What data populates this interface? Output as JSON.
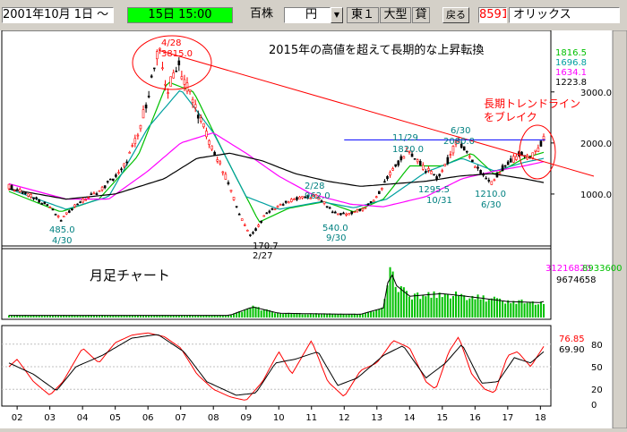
{
  "toolbar": {
    "date_range": "2001年10月 1日 ～",
    "current_time": "15日 15:00",
    "unit_label": "百株",
    "currency_value": "円",
    "market": "東１",
    "size_class": "大型",
    "credit": "貸",
    "back_button": "戻る",
    "stock_code": "8591",
    "stock_name": "オリックス",
    "colors": {
      "time_bg": "#00ff00",
      "code_text": "#ff0000"
    }
  },
  "icons": {
    "dropdown": "dropdown-arrow-icon"
  },
  "chart": {
    "headline": "2015年の高値を超えて長期的な上昇転換",
    "chart_title": "月足チャート",
    "trend_note_line1": "長期トレンドライン",
    "trend_note_line2": "をブレイク",
    "annotations": [
      {
        "text": "4/28",
        "color": "#ff0000"
      },
      {
        "text": "3815.0",
        "color": "#ff0000"
      },
      {
        "text": "485.0",
        "color": "#008080"
      },
      {
        "text": "4/30",
        "color": "#008080"
      },
      {
        "text": "170.7",
        "color": "#000000"
      },
      {
        "text": "2/27",
        "color": "#000000"
      },
      {
        "text": "2/28",
        "color": "#008080"
      },
      {
        "text": "962.0",
        "color": "#008080"
      },
      {
        "text": "540.0",
        "color": "#008080"
      },
      {
        "text": "9/30",
        "color": "#008080"
      },
      {
        "text": "11/29",
        "color": "#008080"
      },
      {
        "text": "1820.0",
        "color": "#008080"
      },
      {
        "text": "6/30",
        "color": "#008080"
      },
      {
        "text": "2080.0",
        "color": "#008080"
      },
      {
        "text": "1295.5",
        "color": "#008080"
      },
      {
        "text": "10/31",
        "color": "#008080"
      },
      {
        "text": "1210.0",
        "color": "#008080"
      },
      {
        "text": "6/30",
        "color": "#008080"
      }
    ],
    "ma_values": [
      {
        "text": "1816.5",
        "color": "#00c000"
      },
      {
        "text": "1696.8",
        "color": "#00a0a0"
      },
      {
        "text": "1634.1",
        "color": "#ff00ff"
      },
      {
        "text": "1223.8",
        "color": "#000000"
      }
    ],
    "volume_values": [
      {
        "text": "31216820",
        "color": "#ff00ff"
      },
      {
        "text": "8933600",
        "color": "#00c000"
      },
      {
        "text": "9674658",
        "color": "#000000"
      }
    ],
    "osc_values": [
      {
        "text": "76.85",
        "color": "#ff0000"
      },
      {
        "text": "69.90",
        "color": "#000000"
      }
    ]
  },
  "chart_data": {
    "type": "line",
    "x_tick_labels": [
      "02",
      "03",
      "04",
      "05",
      "06",
      "07",
      "08",
      "09",
      "10",
      "11",
      "12",
      "13",
      "14",
      "15",
      "16",
      "17",
      "18"
    ],
    "y_tick_labels": [
      "3000.0",
      "2000.0",
      "1000.0"
    ],
    "osc_tick_labels": [
      "80",
      "50",
      "20",
      "0"
    ],
    "y_ticks": [
      3000,
      2000,
      1000
    ],
    "osc_ticks": [
      80,
      50,
      20,
      0
    ],
    "price_range": [
      0,
      4100
    ],
    "osc_range": [
      0,
      100
    ],
    "start_year": 2001.75,
    "end_year": 2018.1,
    "price_key": [
      [
        2001.75,
        1150
      ],
      [
        2002.3,
        1000
      ],
      [
        2003.0,
        750
      ],
      [
        2003.33,
        485
      ],
      [
        2003.8,
        800
      ],
      [
        2004.5,
        1050
      ],
      [
        2005.2,
        1450
      ],
      [
        2005.7,
        2150
      ],
      [
        2006.33,
        3815
      ],
      [
        2006.6,
        3000
      ],
      [
        2006.9,
        3600
      ],
      [
        2007.4,
        2800
      ],
      [
        2007.9,
        2000
      ],
      [
        2008.4,
        1300
      ],
      [
        2008.9,
        450
      ],
      [
        2009.16,
        171
      ],
      [
        2009.6,
        600
      ],
      [
        2010.0,
        780
      ],
      [
        2010.5,
        900
      ],
      [
        2011.16,
        962
      ],
      [
        2011.7,
        620
      ],
      [
        2012.0,
        600
      ],
      [
        2012.6,
        700
      ],
      [
        2013.0,
        950
      ],
      [
        2013.4,
        1400
      ],
      [
        2013.9,
        1820
      ],
      [
        2014.4,
        1550
      ],
      [
        2014.83,
        1295
      ],
      [
        2015.2,
        1700
      ],
      [
        2015.5,
        2080
      ],
      [
        2015.8,
        1750
      ],
      [
        2016.2,
        1400
      ],
      [
        2016.5,
        1210
      ],
      [
        2016.9,
        1550
      ],
      [
        2017.4,
        1800
      ],
      [
        2017.7,
        1700
      ],
      [
        2018.0,
        1950
      ],
      [
        2018.1,
        2050
      ]
    ],
    "trendline": [
      [
        2006.33,
        3815
      ],
      [
        2018.6,
        1700
      ]
    ],
    "horizontal_line": 2060,
    "ma_series": [
      {
        "color": "#00c000",
        "key": [
          [
            2001.75,
            1050
          ],
          [
            2003.33,
            650
          ],
          [
            2004.5,
            900
          ],
          [
            2005.7,
            1750
          ],
          [
            2006.6,
            3200
          ],
          [
            2007.4,
            3000
          ],
          [
            2008.4,
            1700
          ],
          [
            2009.4,
            450
          ],
          [
            2010.3,
            720
          ],
          [
            2011.4,
            850
          ],
          [
            2012.3,
            650
          ],
          [
            2013.2,
            900
          ],
          [
            2014.0,
            1550
          ],
          [
            2015.0,
            1550
          ],
          [
            2015.9,
            1800
          ],
          [
            2016.6,
            1380
          ],
          [
            2017.5,
            1700
          ],
          [
            2018.1,
            1817
          ]
        ]
      },
      {
        "color": "#00a0a0",
        "key": [
          [
            2001.75,
            1100
          ],
          [
            2003.5,
            700
          ],
          [
            2004.8,
            950
          ],
          [
            2006.0,
            2300
          ],
          [
            2007.0,
            3050
          ],
          [
            2008.0,
            2200
          ],
          [
            2009.0,
            950
          ],
          [
            2010.0,
            700
          ],
          [
            2011.3,
            850
          ],
          [
            2012.3,
            730
          ],
          [
            2013.3,
            900
          ],
          [
            2014.5,
            1430
          ],
          [
            2015.6,
            1700
          ],
          [
            2016.6,
            1450
          ],
          [
            2017.5,
            1620
          ],
          [
            2018.1,
            1697
          ]
        ]
      },
      {
        "color": "#ff00ff",
        "key": [
          [
            2001.75,
            1200
          ],
          [
            2003.5,
            900
          ],
          [
            2004.8,
            900
          ],
          [
            2006.0,
            1450
          ],
          [
            2007.0,
            2000
          ],
          [
            2008.0,
            2200
          ],
          [
            2009.0,
            1800
          ],
          [
            2010.0,
            1350
          ],
          [
            2011.0,
            1000
          ],
          [
            2012.2,
            800
          ],
          [
            2013.2,
            750
          ],
          [
            2014.5,
            950
          ],
          [
            2015.6,
            1300
          ],
          [
            2016.6,
            1450
          ],
          [
            2017.5,
            1550
          ],
          [
            2018.1,
            1634
          ]
        ]
      },
      {
        "color": "#000000",
        "key": [
          [
            2001.75,
            1100
          ],
          [
            2003.5,
            900
          ],
          [
            2005.0,
            1000
          ],
          [
            2006.5,
            1300
          ],
          [
            2007.5,
            1700
          ],
          [
            2008.5,
            1800
          ],
          [
            2009.5,
            1650
          ],
          [
            2010.5,
            1400
          ],
          [
            2011.5,
            1250
          ],
          [
            2012.5,
            1150
          ],
          [
            2013.5,
            1200
          ],
          [
            2014.5,
            1250
          ],
          [
            2015.5,
            1350
          ],
          [
            2016.5,
            1400
          ],
          [
            2017.5,
            1300
          ],
          [
            2018.1,
            1224
          ]
        ]
      }
    ],
    "volume_key": [
      [
        2001.75,
        0.04
      ],
      [
        2008.5,
        0.04
      ],
      [
        2009.2,
        0.2
      ],
      [
        2010.0,
        0.08
      ],
      [
        2011.0,
        0.07
      ],
      [
        2012.5,
        0.06
      ],
      [
        2013.2,
        0.18
      ],
      [
        2013.4,
        0.9
      ],
      [
        2013.6,
        0.6
      ],
      [
        2014.0,
        0.4
      ],
      [
        2015.0,
        0.45
      ],
      [
        2016.0,
        0.38
      ],
      [
        2017.0,
        0.3
      ],
      [
        2018.0,
        0.28
      ],
      [
        2018.1,
        0.3
      ]
    ],
    "osc_series": [
      {
        "color": "#ff0000",
        "key": [
          [
            2001.75,
            50
          ],
          [
            2002.0,
            60
          ],
          [
            2002.5,
            30
          ],
          [
            2003.0,
            12
          ],
          [
            2003.4,
            30
          ],
          [
            2004.0,
            75
          ],
          [
            2004.5,
            55
          ],
          [
            2005.0,
            82
          ],
          [
            2005.5,
            92
          ],
          [
            2006.0,
            95
          ],
          [
            2006.5,
            90
          ],
          [
            2007.0,
            75
          ],
          [
            2007.5,
            40
          ],
          [
            2008.0,
            20
          ],
          [
            2008.5,
            10
          ],
          [
            2009.0,
            5
          ],
          [
            2009.5,
            30
          ],
          [
            2010.0,
            70
          ],
          [
            2010.4,
            40
          ],
          [
            2011.0,
            85
          ],
          [
            2011.5,
            30
          ],
          [
            2012.0,
            10
          ],
          [
            2012.5,
            45
          ],
          [
            2013.0,
            55
          ],
          [
            2013.5,
            85
          ],
          [
            2014.0,
            75
          ],
          [
            2014.5,
            30
          ],
          [
            2014.8,
            20
          ],
          [
            2015.2,
            70
          ],
          [
            2015.5,
            90
          ],
          [
            2015.9,
            40
          ],
          [
            2016.3,
            20
          ],
          [
            2016.6,
            15
          ],
          [
            2017.0,
            65
          ],
          [
            2017.3,
            70
          ],
          [
            2017.7,
            50
          ],
          [
            2018.1,
            77
          ]
        ]
      },
      {
        "color": "#000000",
        "key": [
          [
            2001.75,
            55
          ],
          [
            2002.5,
            40
          ],
          [
            2003.2,
            18
          ],
          [
            2003.8,
            50
          ],
          [
            2004.6,
            65
          ],
          [
            2005.5,
            88
          ],
          [
            2006.3,
            93
          ],
          [
            2007.1,
            70
          ],
          [
            2007.8,
            30
          ],
          [
            2008.7,
            12
          ],
          [
            2009.3,
            15
          ],
          [
            2009.9,
            55
          ],
          [
            2010.5,
            60
          ],
          [
            2011.2,
            70
          ],
          [
            2011.8,
            25
          ],
          [
            2012.4,
            35
          ],
          [
            2013.2,
            65
          ],
          [
            2013.8,
            78
          ],
          [
            2014.5,
            35
          ],
          [
            2015.1,
            55
          ],
          [
            2015.6,
            80
          ],
          [
            2016.2,
            28
          ],
          [
            2016.7,
            30
          ],
          [
            2017.2,
            62
          ],
          [
            2017.7,
            55
          ],
          [
            2018.1,
            70
          ]
        ]
      }
    ]
  }
}
